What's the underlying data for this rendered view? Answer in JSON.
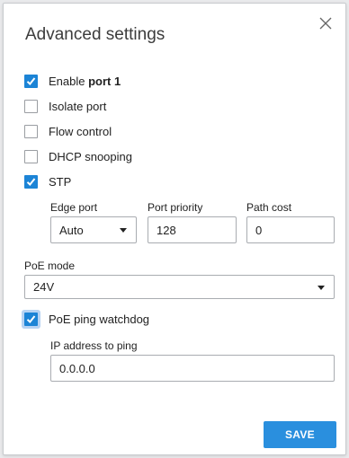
{
  "dialog": {
    "title": "Advanced settings",
    "close_icon": "close-icon",
    "accent_color": "#1c84d6"
  },
  "options": {
    "enable_port": {
      "prefix": "Enable ",
      "bold": "port 1",
      "checked": true
    },
    "isolate_port": {
      "label": "Isolate port",
      "checked": false
    },
    "flow_control": {
      "label": "Flow control",
      "checked": false
    },
    "dhcp_snooping": {
      "label": "DHCP snooping",
      "checked": false
    },
    "stp": {
      "label": "STP",
      "checked": true
    }
  },
  "stp_settings": {
    "edge_port": {
      "label": "Edge port",
      "value": "Auto"
    },
    "port_priority": {
      "label": "Port priority",
      "value": "128"
    },
    "path_cost": {
      "label": "Path cost",
      "value": "0"
    }
  },
  "poe": {
    "mode_label": "PoE mode",
    "mode_value": "24V",
    "ping_watchdog": {
      "label": "PoE ping watchdog",
      "checked": true
    },
    "ip_label": "IP address to ping",
    "ip_value": "0.0.0.0"
  },
  "actions": {
    "save_label": "SAVE",
    "save_color": "#2a8fde"
  }
}
